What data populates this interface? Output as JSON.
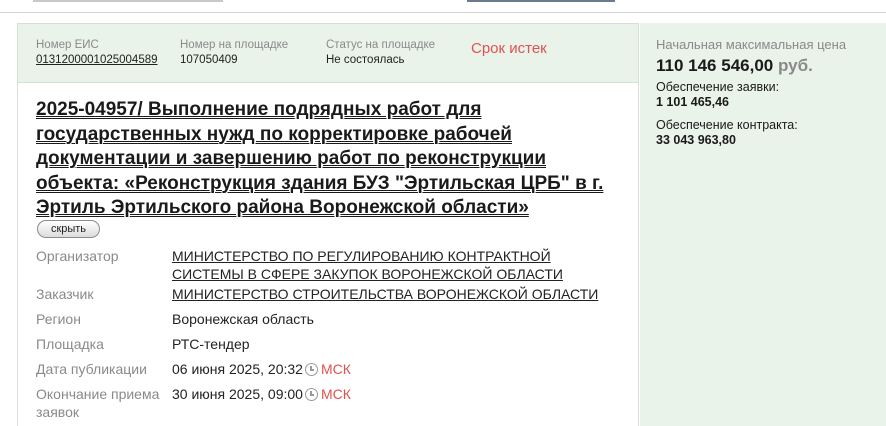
{
  "header": {
    "eis_label": "Номер ЕИС",
    "eis_value": "0131200001025004589",
    "platform_num_label": "Номер на площадке",
    "platform_num_value": "107050409",
    "platform_status_label": "Статус на площадке",
    "platform_status_value": "Не состоялась",
    "deadline_status": "Срок истек"
  },
  "title": "2025-04957/ Выполнение подрядных работ для государственных нужд по корректировке рабочей документации и завершению работ по реконструкции объекта: «Реконструкция здания БУЗ \"Эртильская ЦРБ\" в г. Эртиль Эртильского района Воронежской области»",
  "hide_button": "скрыть",
  "details": {
    "organizer_label": "Организатор",
    "organizer_line1": "МИНИСТЕРСТВО ПО РЕГУЛИРОВАНИЮ КОНТРАКТНОЙ",
    "organizer_line2": "СИСТЕМЫ В СФЕРЕ ЗАКУПОК ВОРОНЕЖСКОЙ ОБЛАСТИ",
    "customer_label": "Заказчик",
    "customer_value": "МИНИСТЕРСТВО СТРОИТЕЛЬСТВА ВОРОНЕЖСКОЙ ОБЛАСТИ",
    "region_label": "Регион",
    "region_value": "Воронежская область",
    "platform_label": "Площадка",
    "platform_value": "РТС-тендер",
    "published_label": "Дата публикации",
    "published_value": "06 июня 2025, 20:32",
    "deadline_label_line1": "Окончание приема",
    "deadline_label_line2": "заявок",
    "deadline_value": "30 июня 2025, 09:00",
    "timezone": "МСК"
  },
  "side": {
    "price_label": "Начальная максимальная цена",
    "price_value": "110 146 546,00",
    "currency": "руб.",
    "bid_security_label": "Обеспечение заявки:",
    "bid_security_value": "1 101 465,46",
    "contract_security_label": "Обеспечение контракта:",
    "contract_security_value": "33 043 963,80"
  },
  "colors": {
    "panel_bg": "#e9f3ea",
    "accent_red": "#e0524f",
    "muted": "#8a8a8a"
  }
}
